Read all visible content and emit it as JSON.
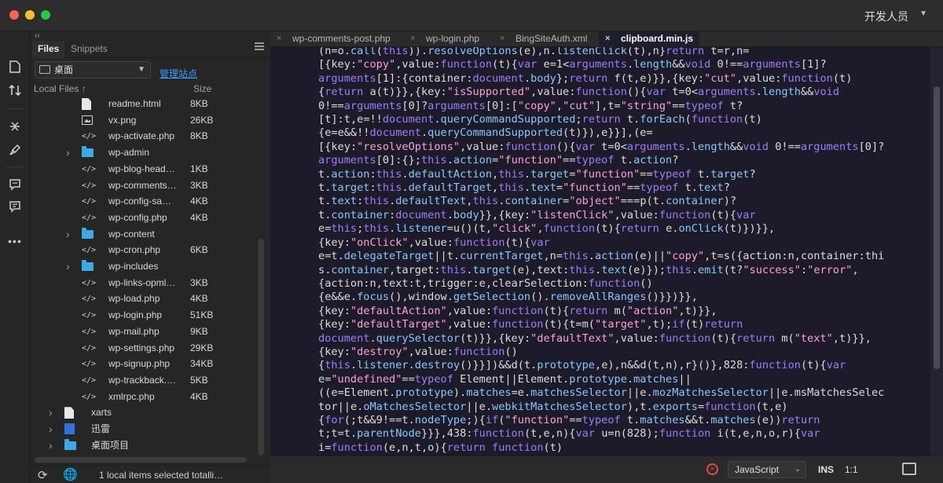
{
  "window": {
    "workspace": "开发人员"
  },
  "toolbar": {
    "icons": [
      "document-icon",
      "sort-arrows-icon",
      "expand-collapse-icon",
      "brush-icon",
      "comment-icon",
      "comment-list-icon",
      "more-icon"
    ],
    "more_label": "•••"
  },
  "panel": {
    "collapse_glyph": "‹‹",
    "tabs": [
      {
        "label": "Files",
        "active": true
      },
      {
        "label": "Snippets",
        "active": false
      }
    ],
    "site": "桌面",
    "manage_link": "管理站点",
    "columns": {
      "name": "Local Files ↑",
      "size": "Size"
    },
    "items": [
      {
        "name": "readme.html",
        "size": "8KB",
        "type": "doc",
        "level": 1
      },
      {
        "name": "vx.png",
        "size": "26KB",
        "type": "img",
        "level": 1
      },
      {
        "name": "wp-activate.php",
        "size": "8KB",
        "type": "code",
        "level": 1
      },
      {
        "name": "wp-admin",
        "size": "",
        "type": "folder",
        "level": 1,
        "expandable": true
      },
      {
        "name": "wp-blog-head…",
        "size": "1KB",
        "type": "code",
        "level": 1
      },
      {
        "name": "wp-comments…",
        "size": "3KB",
        "type": "code",
        "level": 1
      },
      {
        "name": "wp-config-sa…",
        "size": "4KB",
        "type": "code",
        "level": 1
      },
      {
        "name": "wp-config.php",
        "size": "4KB",
        "type": "code",
        "level": 1
      },
      {
        "name": "wp-content",
        "size": "",
        "type": "folder",
        "level": 1,
        "expandable": true
      },
      {
        "name": "wp-cron.php",
        "size": "6KB",
        "type": "code",
        "level": 1
      },
      {
        "name": "wp-includes",
        "size": "",
        "type": "folder",
        "level": 1,
        "expandable": true
      },
      {
        "name": "wp-links-opml…",
        "size": "3KB",
        "type": "code",
        "level": 1
      },
      {
        "name": "wp-load.php",
        "size": "4KB",
        "type": "code",
        "level": 1
      },
      {
        "name": "wp-login.php",
        "size": "51KB",
        "type": "code",
        "level": 1
      },
      {
        "name": "wp-mail.php",
        "size": "9KB",
        "type": "code",
        "level": 1
      },
      {
        "name": "wp-settings.php",
        "size": "29KB",
        "type": "code",
        "level": 1
      },
      {
        "name": "wp-signup.php",
        "size": "34KB",
        "type": "code",
        "level": 1
      },
      {
        "name": "wp-trackback.…",
        "size": "5KB",
        "type": "code",
        "level": 1
      },
      {
        "name": "xmlrpc.php",
        "size": "4KB",
        "type": "code",
        "level": 1
      },
      {
        "name": "xarts",
        "size": "",
        "type": "doc",
        "level": 0,
        "expandable": true
      },
      {
        "name": "迅雷",
        "size": "",
        "type": "box",
        "level": 0,
        "expandable": true
      },
      {
        "name": "桌面项目",
        "size": "",
        "type": "folder",
        "level": 0,
        "expandable": true
      }
    ],
    "status": "1 local items selected totalli…"
  },
  "editor": {
    "tabs": [
      {
        "label": "wp-comments-post.php",
        "active": false
      },
      {
        "label": "wp-login.php",
        "active": false
      },
      {
        "label": "BingSiteAuth.xml",
        "active": false
      },
      {
        "label": "clipboard.min.js",
        "active": true
      }
    ],
    "close_glyph": "×",
    "code_lines": [
      "(n=o.call(this)).resolveOptions(e),n.listenClick(t),n}return t=r,n=",
      "[{key:\"copy\",value:function(t){var e=1<arguments.length&&void 0!==arguments[1]?",
      "arguments[1]:{container:document.body};return f(t,e)}},{key:\"cut\",value:function(t)",
      "{return a(t)}},{key:\"isSupported\",value:function(){var t=0<arguments.length&&void",
      "0!==arguments[0]?arguments[0]:[\"copy\",\"cut\"],t=\"string\"==typeof t?",
      "[t]:t,e=!!document.queryCommandSupported;return t.forEach(function(t)",
      "{e=e&&!!document.queryCommandSupported(t)}),e}}],(e=",
      "[{key:\"resolveOptions\",value:function(){var t=0<arguments.length&&void 0!==arguments[0]?",
      "arguments[0]:{};this.action=\"function\"==typeof t.action?",
      "t.action:this.defaultAction,this.target=\"function\"==typeof t.target?",
      "t.target:this.defaultTarget,this.text=\"function\"==typeof t.text?",
      "t.text:this.defaultText,this.container=\"object\"===p(t.container)?",
      "t.container:document.body}},{key:\"listenClick\",value:function(t){var",
      "e=this;this.listener=u()(t,\"click\",function(t){return e.onClick(t)})}},",
      "{key:\"onClick\",value:function(t){var",
      "e=t.delegateTarget||t.currentTarget,n=this.action(e)||\"copy\",t=s({action:n,container:thi",
      "s.container,target:this.target(e),text:this.text(e)});this.emit(t?\"success\":\"error\",",
      "{action:n,text:t,trigger:e,clearSelection:function()",
      "{e&&e.focus(),window.getSelection().removeAllRanges()}})}},",
      "{key:\"defaultAction\",value:function(t){return m(\"action\",t)}},",
      "{key:\"defaultTarget\",value:function(t){t=m(\"target\",t);if(t)return",
      "document.querySelector(t)}},{key:\"defaultText\",value:function(t){return m(\"text\",t)}},",
      "{key:\"destroy\",value:function()",
      "{this.listener.destroy()}}])&&d(t.prototype,e),n&&d(t,n),r}()},828:function(t){var",
      "e=\"undefined\"==typeof Element||Element.prototype.matches||",
      "((e=Element.prototype).matches=e.matchesSelector||e.mozMatchesSelector||e.msMatchesSelec",
      "tor||e.oMatchesSelector||e.webkitMatchesSelector),t.exports=function(t,e)",
      "{for(;t&&9!==t.nodeType;){if(\"function\"==typeof t.matches&&t.matches(e))return",
      "t;t=t.parentNode}}},438:function(t,e,n){var u=n(828);function i(t,e,n,o,r){var",
      "i=function(e,n,t,o){return function(t)"
    ]
  },
  "statusbar": {
    "error_glyph": "×",
    "language": "JavaScript",
    "mode": "INS",
    "position": "1:1"
  }
}
